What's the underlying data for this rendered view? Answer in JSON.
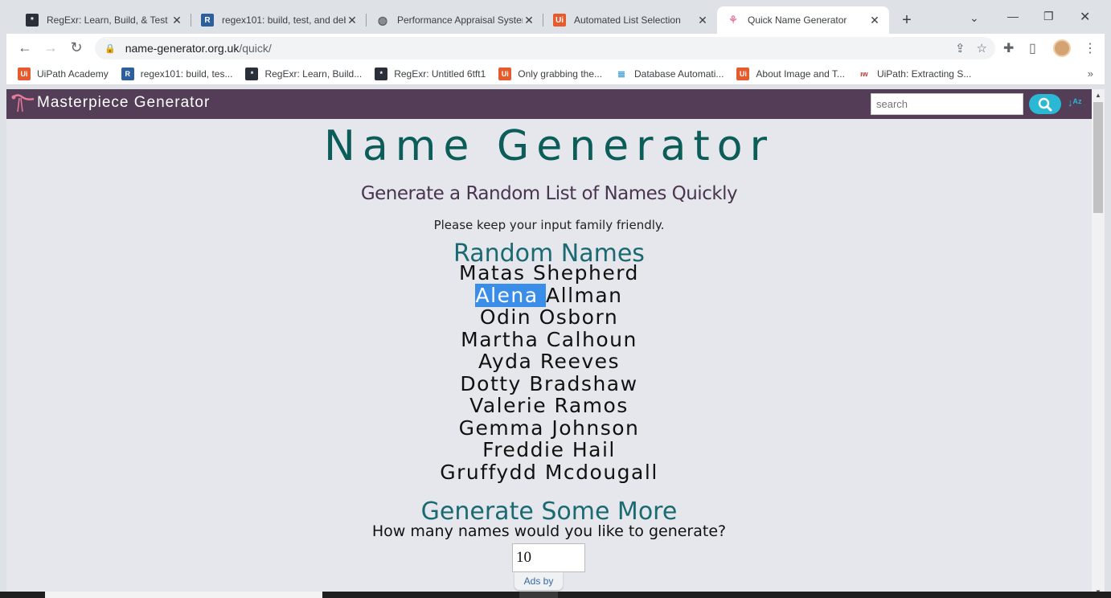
{
  "tabs": [
    {
      "title": "RegExr: Learn, Build, & Test R",
      "fav": "rx",
      "color": "#2b2f3a"
    },
    {
      "title": "regex101: build, test, and deb",
      "fav": "R",
      "color": "#2c5f9e"
    },
    {
      "title": "Performance Appraisal Syster",
      "fav": "globe",
      "color": "#5f6368"
    },
    {
      "title": "Automated List Selection",
      "fav": "Ui",
      "color": "#e55b2d"
    },
    {
      "title": "Quick Name Generator",
      "fav": "flamingo",
      "color": "#e87a9a",
      "active": true
    }
  ],
  "address": {
    "domain": "name-generator.org.uk",
    "path": "/quick/"
  },
  "bookmarks": [
    {
      "label": "UiPath Academy",
      "fav": "Ui",
      "color": "#e55b2d"
    },
    {
      "label": "regex101: build, tes...",
      "fav": "R",
      "color": "#2c5f9e"
    },
    {
      "label": "RegExr: Learn, Build...",
      "fav": "rx",
      "color": "#2b2f3a"
    },
    {
      "label": "RegExr: Untitled 6tft1",
      "fav": "rx",
      "color": "#2b2f3a"
    },
    {
      "label": "Only grabbing the...",
      "fav": "Ui",
      "color": "#e55b2d"
    },
    {
      "label": "Database Automati...",
      "fav": "db",
      "color": "#4aa3d8"
    },
    {
      "label": "About Image and T...",
      "fav": "Ui",
      "color": "#e55b2d"
    },
    {
      "label": "UiPath: Extracting S...",
      "fav": "iw",
      "color": "#c0392b"
    }
  ],
  "site": {
    "brand": "Masterpiece Generator",
    "search_placeholder": "search"
  },
  "main": {
    "title": "Name Generator",
    "subtitle": "Generate a Random List of Names Quickly",
    "note": "Please keep your input family friendly.",
    "list_heading": "Random Names",
    "names": [
      {
        "first": "Matas",
        "last": "Shepherd"
      },
      {
        "first": "Alena",
        "last": "Allman",
        "selected_first": true
      },
      {
        "first": "Odin",
        "last": "Osborn"
      },
      {
        "first": "Martha",
        "last": "Calhoun"
      },
      {
        "first": "Ayda",
        "last": "Reeves"
      },
      {
        "first": "Dotty",
        "last": "Bradshaw"
      },
      {
        "first": "Valerie",
        "last": "Ramos"
      },
      {
        "first": "Gemma",
        "last": "Johnson"
      },
      {
        "first": "Freddie",
        "last": "Hail"
      },
      {
        "first": "Gruffydd",
        "last": "Mcdougall"
      }
    ],
    "more_heading": "Generate Some More",
    "question": "How many names would you like to generate?",
    "count_value": "10",
    "ads_label": "Ads by"
  },
  "colors": {
    "site_bar": "#543e57",
    "title": "#0c5c5a",
    "accent": "#2bb8d5",
    "selection": "#3b8ee8"
  }
}
